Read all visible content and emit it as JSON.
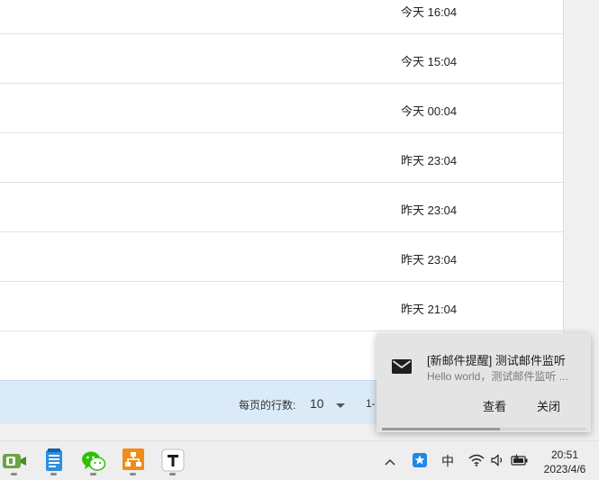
{
  "mail_list": {
    "rows": [
      {
        "time": "今天 16:04"
      },
      {
        "time": "今天 15:04"
      },
      {
        "time": "今天 00:04"
      },
      {
        "time": "昨天 23:04"
      },
      {
        "time": "昨天 23:04"
      },
      {
        "time": "昨天 23:04"
      },
      {
        "time": "昨天 21:04"
      },
      {
        "time": ""
      }
    ]
  },
  "pagination": {
    "rows_per_page_label": "每页的行数:",
    "rows_per_page_value": "10",
    "range_text": "1-"
  },
  "notification": {
    "icon": "mail-icon",
    "title": "[新邮件提醒] 测试邮件监听",
    "body": "Hello world，测试邮件监听 ...",
    "view_label": "查看",
    "close_label": "关闭",
    "progress": 0.58
  },
  "taskbar": {
    "apps": [
      {
        "name": "evernote-app",
        "icon": "green-app-icon"
      },
      {
        "name": "notepad-app",
        "icon": "notepad-icon"
      },
      {
        "name": "wechat-app",
        "icon": "wechat-icon"
      },
      {
        "name": "network-app",
        "icon": "orange-network-icon"
      },
      {
        "name": "typora-app",
        "icon": "typora-icon"
      }
    ],
    "tray": {
      "chevron": "chevron-up-icon",
      "input_method": "中",
      "clock_time": "20:51",
      "clock_date": "2023/4/6"
    }
  },
  "colors": {
    "pager_bg": "#dbeaf7",
    "toast_bg": "#e4e4e4",
    "taskbar_bg": "#eeeeee"
  }
}
